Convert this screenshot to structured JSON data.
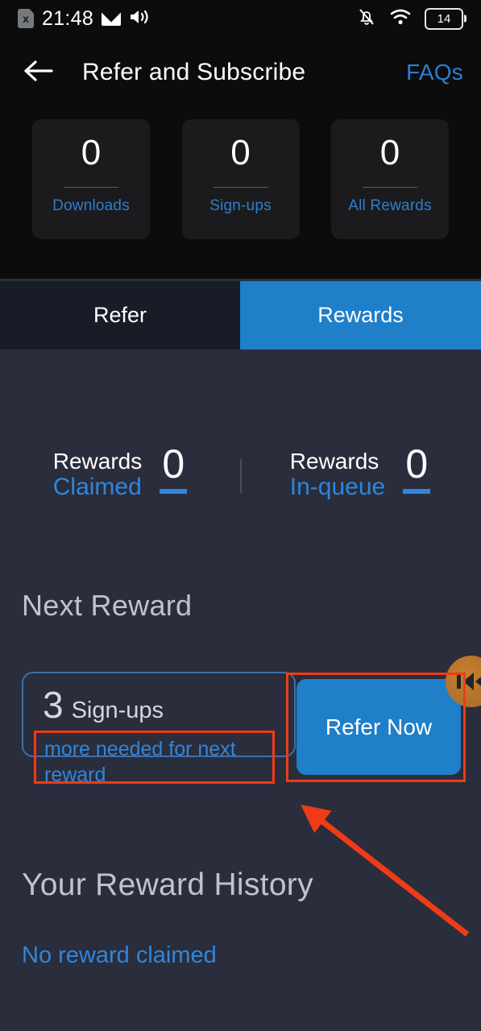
{
  "status_bar": {
    "sim_icon": "sim-card-x-icon",
    "time": "21:48",
    "mail_icon": "mail-icon",
    "volume_icon": "speaker-volume-icon",
    "silent_icon": "bell-off-icon",
    "wifi_icon": "wifi-icon",
    "battery_level": "14",
    "battery_icon": "battery-icon"
  },
  "app_bar": {
    "back_icon": "back-arrow-icon",
    "title": "Refer and Subscribe",
    "faqs_label": "FAQs"
  },
  "stats": [
    {
      "value": "0",
      "label": "Downloads"
    },
    {
      "value": "0",
      "label": "Sign-ups"
    },
    {
      "value": "0",
      "label": "All Rewards"
    }
  ],
  "tabs": [
    {
      "label": "Refer",
      "active": false
    },
    {
      "label": "Rewards",
      "active": true
    }
  ],
  "rewards_summary": [
    {
      "title": "Rewards",
      "subtitle": "Claimed",
      "value": "0"
    },
    {
      "title": "Rewards",
      "subtitle": "In-queue",
      "value": "0"
    }
  ],
  "next_reward": {
    "heading": "Next Reward",
    "count": "3",
    "unit": "Sign-ups",
    "note": "more needed for next reward",
    "cta_label": "Refer Now"
  },
  "reward_history": {
    "heading": "Your Reward History",
    "empty_text": "No reward claimed"
  },
  "floating_widget": {
    "icon": "orange-circle-widget-icon"
  },
  "colors": {
    "accent_blue": "#1f7fc8",
    "link_blue": "#2f86dc",
    "annotation_red": "#ef3b16",
    "header_black": "#0c0c0c",
    "body_navy": "#2a2d3c",
    "card_dark": "#1b1b1d"
  }
}
